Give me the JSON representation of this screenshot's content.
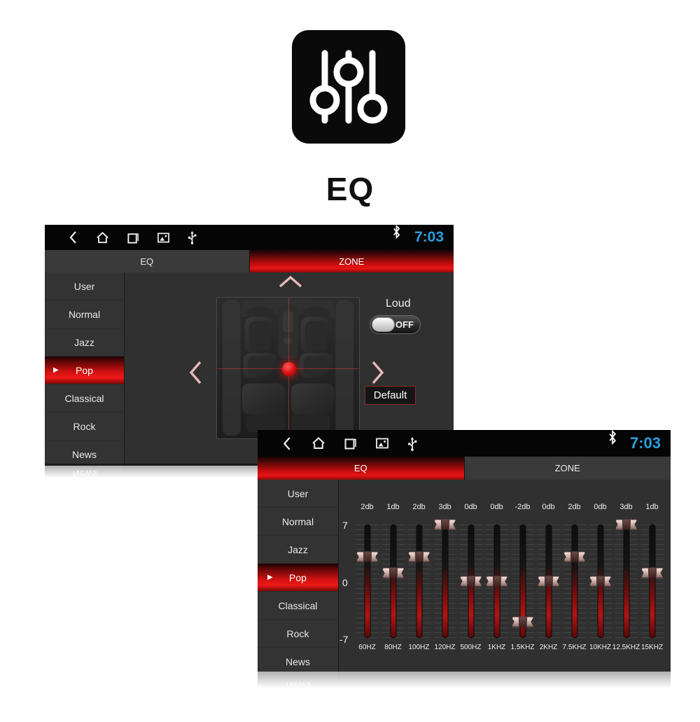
{
  "hero": {
    "icon_name": "eq-sliders-icon",
    "title": "EQ"
  },
  "statusbar": {
    "icons": [
      "back-icon",
      "home-icon",
      "recents-icon",
      "gallery-icon",
      "usb-icon"
    ],
    "bluetooth_icon": "bluetooth-icon",
    "time": "7:03",
    "time_color": "#2b9fe0"
  },
  "tabs": {
    "eq_label": "EQ",
    "zone_label": "ZONE"
  },
  "presets": {
    "items": [
      "User",
      "Normal",
      "Jazz",
      "Pop",
      "Classical",
      "Rock",
      "News"
    ],
    "selected": "Pop",
    "caret": "▶"
  },
  "zone_screen": {
    "active_tab": "ZONE",
    "loud_label": "Loud",
    "loud_state": "OFF",
    "default_label": "Default",
    "arrows": {
      "up": "chevron-up-icon",
      "down": "chevron-down-icon",
      "left": "chevron-left-icon",
      "right": "chevron-right-icon"
    },
    "position_dot": "zone-position-dot",
    "accent_color": "#e01414"
  },
  "eq_screen": {
    "active_tab": "EQ",
    "scale": {
      "top": "7",
      "mid": "0",
      "bottom": "-7"
    },
    "bands": [
      {
        "hz": "60HZ",
        "db": "2db",
        "value": 3
      },
      {
        "hz": "80HZ",
        "db": "1db",
        "value": 1
      },
      {
        "hz": "100HZ",
        "db": "2db",
        "value": 3
      },
      {
        "hz": "120HZ",
        "db": "3db",
        "value": 7
      },
      {
        "hz": "500HZ",
        "db": "0db",
        "value": 0
      },
      {
        "hz": "1KHZ",
        "db": "0db",
        "value": 0
      },
      {
        "hz": "1.5KHZ",
        "db": "-2db",
        "value": -5
      },
      {
        "hz": "2KHZ",
        "db": "0db",
        "value": 0
      },
      {
        "hz": "7.5KHZ",
        "db": "2db",
        "value": 3
      },
      {
        "hz": "10KHZ",
        "db": "0db",
        "value": 0
      },
      {
        "hz": "12.5KHZ",
        "db": "3db",
        "value": 7
      },
      {
        "hz": "15KHZ",
        "db": "1db",
        "value": 1
      }
    ]
  }
}
